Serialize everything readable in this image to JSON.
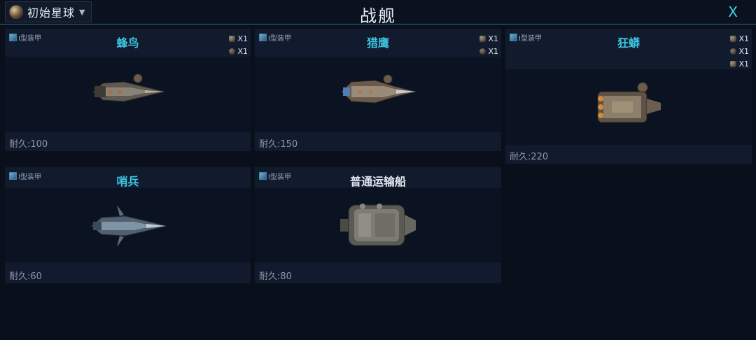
{
  "header": {
    "planet_selector": "初始星球",
    "title": "战舰",
    "close_label": "X"
  },
  "ships": [
    {
      "name": "蜂鸟",
      "armor": "I型装甲",
      "durability": "耐久:100",
      "costs": [
        "X1",
        "X1"
      ]
    },
    {
      "name": "猎鹰",
      "armor": "I型装甲",
      "durability": "耐久:150",
      "costs": [
        "X1",
        "X1"
      ]
    },
    {
      "name": "狂蟒",
      "armor": "I型装甲",
      "durability": "耐久:220",
      "costs": [
        "X1",
        "X1",
        "X1"
      ]
    },
    {
      "name": "哨兵",
      "armor": "I型装甲",
      "durability": "耐久:60",
      "costs": []
    },
    {
      "name": "普通运输船",
      "armor": "I型装甲",
      "durability": "耐久:80",
      "costs": []
    }
  ],
  "colors": {
    "accent": "#3cc6e2",
    "background": "#0a0f1c",
    "card": "#111b2d"
  }
}
